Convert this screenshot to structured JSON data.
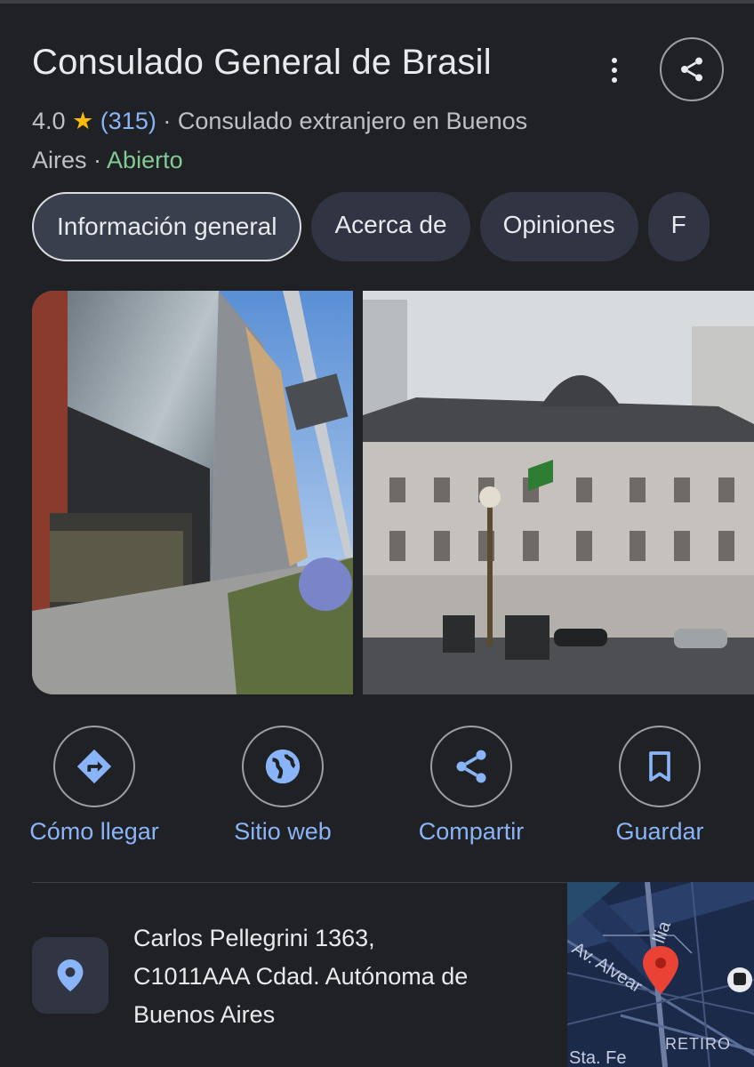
{
  "place": {
    "title": "Consulado General de Brasil",
    "rating": "4.0",
    "star": "★",
    "reviews": "(315)",
    "separator": "·",
    "category_line1": "Consulado extranjero en Buenos",
    "category_line2": "Aires",
    "status": "Abierto"
  },
  "tabs": [
    {
      "label": "Información general",
      "active": true
    },
    {
      "label": "Acerca de",
      "active": false
    },
    {
      "label": "Opiniones",
      "active": false
    },
    {
      "label": "F",
      "active": false
    }
  ],
  "actions": [
    {
      "label": "Cómo llegar",
      "icon": "directions-icon"
    },
    {
      "label": "Sitio web",
      "icon": "globe-icon"
    },
    {
      "label": "Compartir",
      "icon": "share-icon"
    },
    {
      "label": "Guardar",
      "icon": "bookmark-icon"
    }
  ],
  "address": {
    "line1": "Carlos Pellegrini 1363,",
    "line2": "C1011AAA Cdad. Autónoma de",
    "line3": "Buenos Aires"
  },
  "map": {
    "labels": [
      "Av. Alvear",
      "llia",
      "RETIRO",
      "Sta. Fe"
    ]
  },
  "colors": {
    "background": "#202124",
    "accent": "#8ab4f8",
    "open": "#81c995",
    "star": "#fbbc04",
    "pin": "#ea4335"
  }
}
